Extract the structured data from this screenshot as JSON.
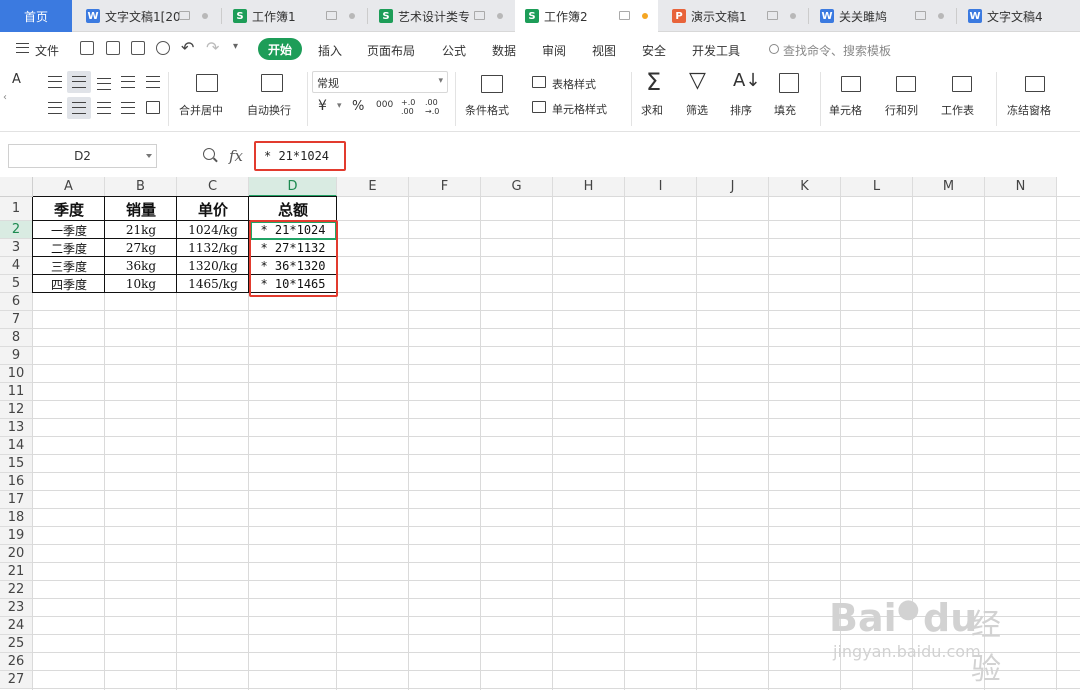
{
  "tabs": [
    {
      "label": "首页",
      "type": "home"
    },
    {
      "label": "文字文稿1[20",
      "type": "doc",
      "icon": "W",
      "color": "#3b7ae0"
    },
    {
      "label": "工作簿1",
      "type": "sheet",
      "icon": "S",
      "color": "#1d9d58"
    },
    {
      "label": "艺术设计类专",
      "type": "sheet",
      "icon": "S",
      "color": "#1d9d58"
    },
    {
      "label": "工作簿2",
      "type": "sheet",
      "icon": "S",
      "color": "#1d9d58",
      "active": true
    },
    {
      "label": "演示文稿1",
      "type": "ppt",
      "icon": "P",
      "color": "#e8633a"
    },
    {
      "label": "关关雎鸠",
      "type": "doc",
      "icon": "W",
      "color": "#3b7ae0"
    },
    {
      "label": "文字文稿4",
      "type": "doc",
      "icon": "W",
      "color": "#3b7ae0"
    }
  ],
  "menu": {
    "file": "文件",
    "items": [
      "开始",
      "插入",
      "页面布局",
      "公式",
      "数据",
      "审阅",
      "视图",
      "安全",
      "开发工具"
    ],
    "search": "查找命令、搜索模板"
  },
  "ribbon": {
    "merge": "合并居中",
    "wrap": "自动换行",
    "format_value": "常规",
    "currency": "¥",
    "percent": "%",
    "thousands": "000",
    "dec_inc": "+.0\n.00",
    "dec_dec": ".00\n→.0",
    "cond_format": "条件格式",
    "table_style": "表格样式",
    "cell_style": "单元格样式",
    "sum": "求和",
    "filter": "筛选",
    "sort": "排序",
    "fill": "填充",
    "cell": "单元格",
    "row_col": "行和列",
    "worksheet": "工作表",
    "freeze": "冻结窗格"
  },
  "formula_bar": {
    "name_box": "D2",
    "fx": "fx",
    "formula": "* 21*1024"
  },
  "columns": [
    "A",
    "B",
    "C",
    "D",
    "E",
    "F",
    "G",
    "H",
    "I",
    "J",
    "K",
    "L",
    "M",
    "N"
  ],
  "rows": [
    "1",
    "2",
    "3",
    "4",
    "5",
    "6",
    "7",
    "8",
    "9",
    "10",
    "11",
    "12",
    "13",
    "14",
    "15",
    "16",
    "17",
    "18",
    "19",
    "20",
    "21",
    "22",
    "23",
    "24",
    "25",
    "26",
    "27"
  ],
  "table": {
    "headers": [
      "季度",
      "销量",
      "单价",
      "总额"
    ],
    "data": [
      [
        "一季度",
        "21kg",
        "1024/kg",
        "* 21*1024"
      ],
      [
        "二季度",
        "27kg",
        "1132/kg",
        "* 27*1132"
      ],
      [
        "三季度",
        "36kg",
        "1320/kg",
        "* 36*1320"
      ],
      [
        "四季度",
        "10kg",
        "1465/kg",
        "* 10*1465"
      ]
    ]
  },
  "selected_cell": "D2",
  "watermark": {
    "brand": "Bai",
    "brand2": "du",
    "cn": "经验",
    "url": "jingyan.baidu.com"
  },
  "colors": {
    "accent": "#1d9d58",
    "highlight": "#e23b2e",
    "tab_home": "#3b7ae0"
  }
}
